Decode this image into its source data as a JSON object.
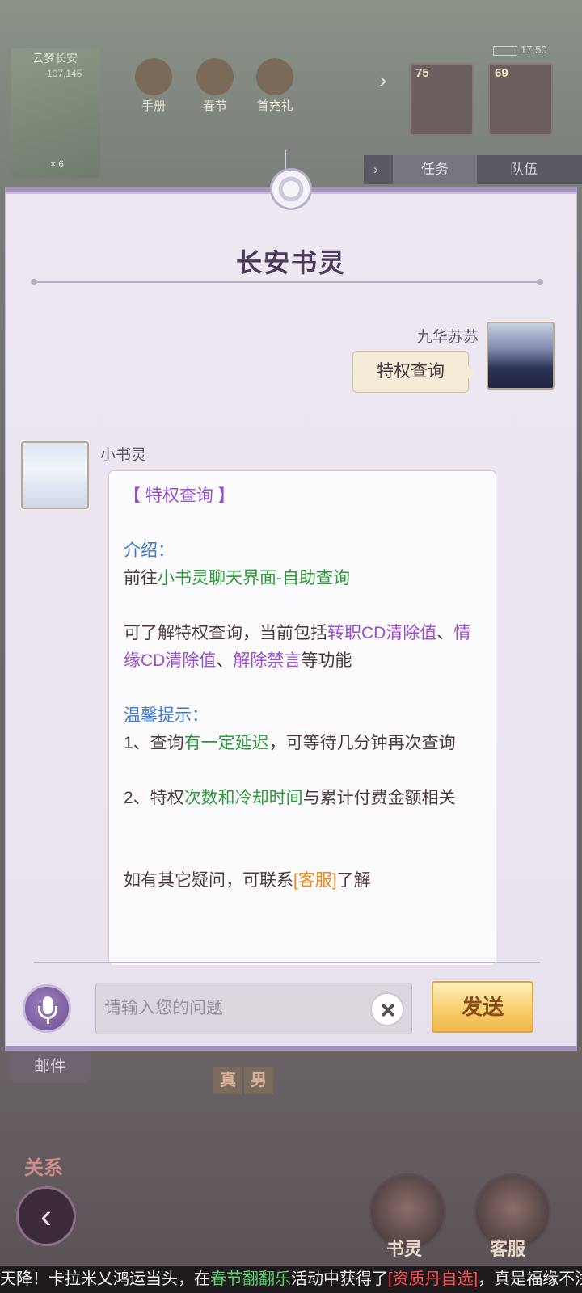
{
  "background": {
    "minimap": {
      "title": "云梦长安",
      "coords": "107,145",
      "count": "× 6"
    },
    "top_icons": [
      {
        "label": "手册",
        "icon": "book-icon"
      },
      {
        "label": "春节",
        "icon": "lion-icon"
      },
      {
        "label": "首充礼",
        "icon": "gift-icon"
      }
    ],
    "party": [
      {
        "level": "75"
      },
      {
        "level": "69"
      }
    ],
    "time": "17:50",
    "tabs": [
      {
        "label": "任务"
      },
      {
        "label": "队伍"
      }
    ],
    "mail_label": "邮件",
    "relation_label": "关系",
    "real_tags": [
      "真",
      "男"
    ],
    "fab_book_label": "书灵",
    "fab_service_label": "客服"
  },
  "dialog": {
    "title": "长安书灵",
    "user": {
      "name": "九华苏苏",
      "message": "特权查询"
    },
    "bot": {
      "name": "小书灵",
      "header": "【 特权查询 】",
      "intro_heading": "介绍：",
      "intro_prefix": "前往",
      "intro_link": "小书灵聊天界面-自助查询",
      "desc_prefix": "可了解特权查询，当前包括",
      "desc_item1": "转职CD清除值",
      "desc_sep1": "、",
      "desc_item2": "情缘CD清除值",
      "desc_sep2": "、",
      "desc_item3": "解除禁言",
      "desc_suffix": "等功能",
      "tips_heading": "温馨提示：",
      "tip1_prefix": "1、查询",
      "tip1_highlight": "有一定延迟",
      "tip1_suffix": "，可等待几分钟再次查询",
      "tip2_prefix": "2、特权",
      "tip2_highlight": "次数和冷却时间",
      "tip2_suffix": "与累计付费金额相关",
      "contact_prefix": "如有其它疑问，可联系",
      "contact_link": "[客服]",
      "contact_suffix": "了解"
    },
    "input": {
      "placeholder": "请输入您的问题",
      "value": ""
    },
    "send_label": "发送"
  },
  "ticker": {
    "prefix": "天降！卡拉米乂鸿运当头，在",
    "event": "春节翻翻乐",
    "middle": "活动中获得了",
    "item": "[资质丹自选]",
    "suffix": "，真是福缘不浅"
  },
  "colors": {
    "dialog_border": "#a394bf",
    "highlight_purple": "#9a4fd0",
    "highlight_blue": "#3d7ad6",
    "highlight_green": "#2a9a3a",
    "highlight_orange": "#e88a1e",
    "send_button": "#f8cf6e"
  }
}
